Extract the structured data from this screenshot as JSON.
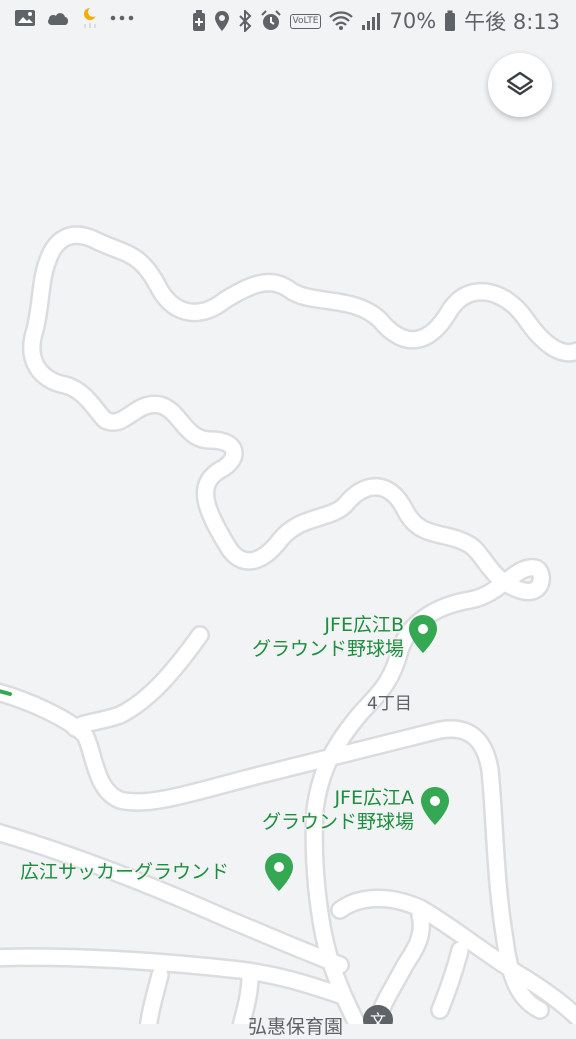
{
  "status_bar": {
    "battery_percent": "70%",
    "time": "午後 8:13",
    "volte": "VoLTE",
    "icons_left": [
      "image-icon",
      "cloud-icon",
      "weather-night-icon",
      "more-dots-icon"
    ],
    "icons_right": [
      "battery-saver-icon",
      "location-icon",
      "bluetooth-icon",
      "alarm-icon",
      "volte-icon",
      "wifi-icon",
      "signal-icon",
      "battery-icon"
    ]
  },
  "map": {
    "layers_button_icon": "layers-icon",
    "places": [
      {
        "line1": "JFE広江B",
        "line2": "グラウンド野球場",
        "icon": "green-pin-icon"
      },
      {
        "line1": "JFE広江A",
        "line2": "グラウンド野球場",
        "icon": "green-pin-icon"
      },
      {
        "line1": "広江サッカーグラウンド",
        "icon": "green-pin-icon"
      }
    ],
    "area_label": "4丁目",
    "school": {
      "label": "弘惠保育園",
      "icon": "school-icon"
    },
    "colors": {
      "background": "#f1f3f4",
      "road": "#ffffff",
      "road_edge": "#dadce0",
      "poi_green": "#1e8e3e",
      "pin_green": "#34a853"
    }
  }
}
